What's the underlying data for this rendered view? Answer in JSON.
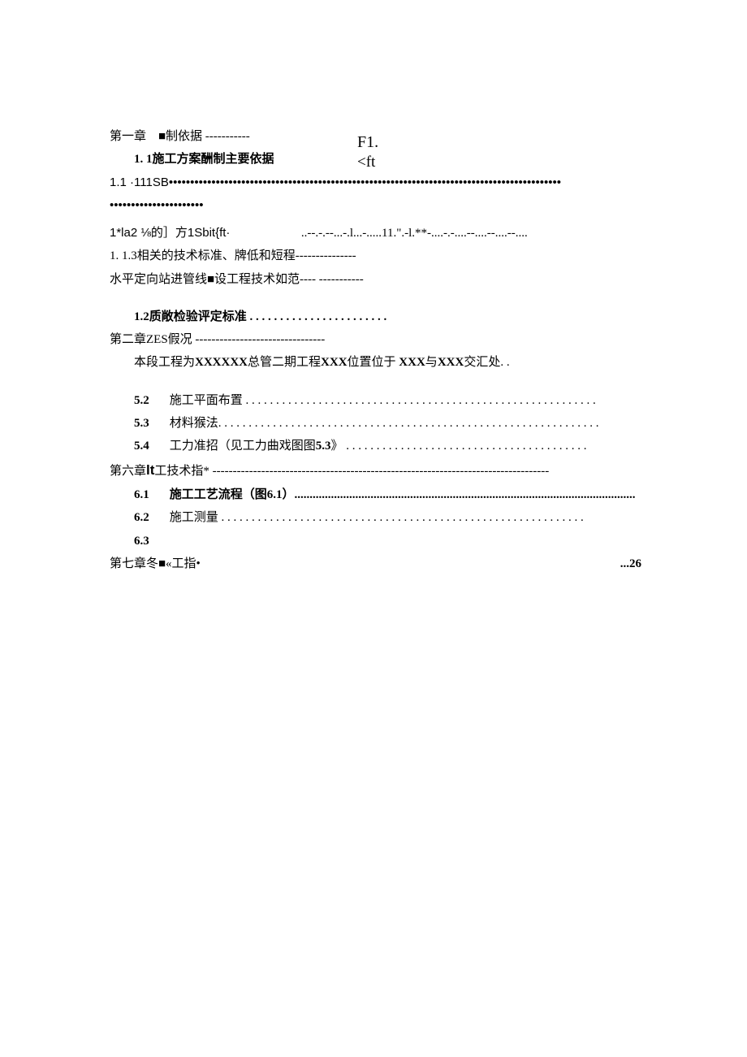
{
  "header": {
    "f1": "F1.",
    "ft": "<ft"
  },
  "lines": {
    "l1": "第一章　■制依据 -----------",
    "l2_prefix": "1.  1",
    "l2": "施工方案酬制主要依据",
    "l3": "1.1  ·111SB••••••••••••••••••••••••••••••••••••••••••••••••••••••••••••••••••••••••••••••••••••••••••••",
    "l3b": "••••••••••••••••••••••",
    "l4a": "1*la2      ⅛的］方1Sbit{ft·",
    "l4b": "..--.-.--...-.l...-.....11.\".-l.**-....-.-....--....--....--....",
    "l5": "1.  1.3相关的技术标准、牌低和短程---------------",
    "l6": "水平定向站进管线■设工程技术如范---- -----------",
    "l7_prefix": "1.2",
    "l7": "质敞检验评定标准 . . . . . . . . . . . . . . . . . . . . . . .",
    "l8": "第二章ZES假况 --------------------------------",
    "l9a": "本段工程为",
    "l9b": "XXXXXX",
    "l9c": "总管二期工程",
    "l9d": "XXX",
    "l9e": "位置位于 ",
    "l9f": "XXX",
    "l9g": "与",
    "l9h": "XXX",
    "l9i": "交汇处. .",
    "l10_num": "5.2",
    "l10": "施工平面布置  . . . . . . . . . . . . . . . . . . . . . . . . . . . . . . . . . . . . . . . . . . . . . . . . . . . . . . . . . .",
    "l11_num": "5.3",
    "l11": "材料猴法. . . . . . . . . . . . . . . . . . . . . . . . . . . . . . . . . . . . . . . . . . . . . . . . . . . . . . . . . . . . . . .",
    "l12_num": "5.4",
    "l12a": "工力准招（见工力曲戏图图",
    "l12b": "5.3",
    "l12c": "》  . . . . . . . . . . . . . . . . . . . . . . . . . . . . . . . . . . . . . . . .",
    "l13a": "第六章",
    "l13b": "lt",
    "l13c": "工技术指* -----------------------------------------------------------------------------------",
    "l14_num": "6.1",
    "l14a": "施工工艺流程（图",
    "l14b": "6.1",
    "l14c": "）................................................................................................................",
    "l15_num": "6.2",
    "l15": "施工测量  . . . . . . . . . . . . . . . . . . . . . . . . . . . . . . . . . . . . . . . . . . . . . . . . . . . . . . . . . . . .",
    "l16_num": "6.3",
    "l17": "第七章冬■«工指•",
    "l17_page": "...26"
  }
}
